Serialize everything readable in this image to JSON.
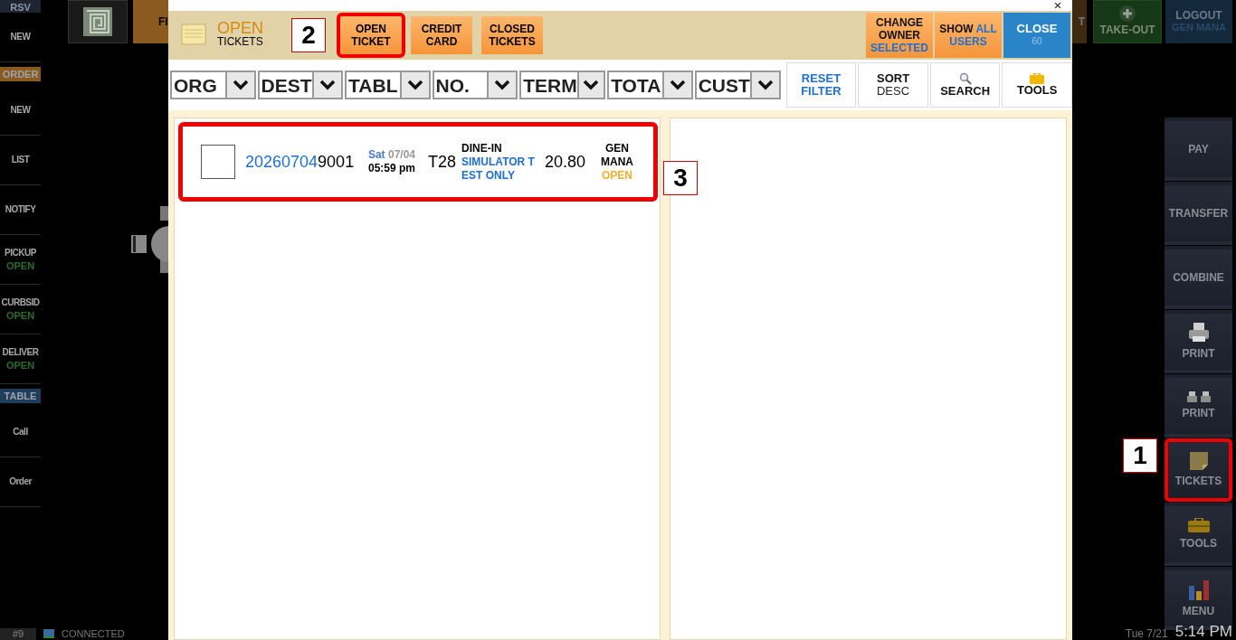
{
  "top_bar": {
    "corner_label": "RSV",
    "partial_tile": "FI",
    "partial_tile_right": "T",
    "take_out": "TAKE-OUT",
    "logout": {
      "label": "LOGOUT",
      "user": "GEN MANA"
    }
  },
  "sidebar": [
    {
      "kind": "item",
      "label": "NEW"
    },
    {
      "kind": "header",
      "label": "ORDER",
      "color": "#8a5a1e"
    },
    {
      "kind": "item",
      "label": "NEW"
    },
    {
      "kind": "item",
      "label": "LIST"
    },
    {
      "kind": "item",
      "label": "NOTIFY"
    },
    {
      "kind": "item",
      "label": "PICKUP",
      "status": "OPEN"
    },
    {
      "kind": "item",
      "label": "CURBSID",
      "status": "OPEN"
    },
    {
      "kind": "item",
      "label": "DELIVER",
      "status": "OPEN"
    },
    {
      "kind": "header",
      "label": "TABLE",
      "color": "#1f3d5c"
    },
    {
      "kind": "item",
      "label": "Call"
    },
    {
      "kind": "item",
      "label": "Order"
    }
  ],
  "right_buttons": [
    {
      "kind": "text",
      "label": "PAY",
      "selected": false
    },
    {
      "kind": "text",
      "label": "TRANSFER",
      "selected": false
    },
    {
      "kind": "text",
      "label": "COMBINE",
      "selected": false
    },
    {
      "kind": "printer",
      "label": "PRINT",
      "selected": false
    },
    {
      "kind": "printers",
      "label": "PRINT",
      "selected": false
    },
    {
      "kind": "ticket",
      "label": "TICKETS",
      "selected": true,
      "callout": "1"
    },
    {
      "kind": "toolbox",
      "label": "TOOLS",
      "selected": false
    },
    {
      "kind": "chart",
      "label": "MENU",
      "selected": false
    }
  ],
  "status_bar": {
    "station": "#9",
    "connection": "CONNECTED",
    "date": "Tue 7/21",
    "time": "5:14 PM"
  },
  "dialog": {
    "heading": {
      "title": "OPEN",
      "subtitle": "TICKETS"
    },
    "tabs": [
      {
        "lines": [
          "OPEN",
          "TICKET"
        ],
        "selected": true,
        "callout": "2"
      },
      {
        "lines": [
          "CREDIT",
          "CARD"
        ],
        "selected": false
      },
      {
        "lines": [
          "CLOSED",
          "TICKETS"
        ],
        "selected": false
      }
    ],
    "change_owner": {
      "lines": [
        "CHANGE",
        "OWNER"
      ],
      "state": "SELECTED"
    },
    "show_all": {
      "prefix": "SHOW",
      "highlight": "ALL",
      "suffix": "USERS"
    },
    "close": {
      "label": "CLOSE",
      "countdown": "60"
    },
    "filters": [
      "ORG",
      "DEST",
      "TABL",
      "NO.",
      "TERM",
      "TOTA",
      "CUST"
    ],
    "tools": [
      {
        "kind": "reset",
        "lines": [
          "RESET",
          "FILTER"
        ]
      },
      {
        "kind": "sort",
        "lines": [
          "SORT",
          "DESC"
        ]
      },
      {
        "kind": "search",
        "lines": [
          "SEARCH"
        ]
      },
      {
        "kind": "tools",
        "lines": [
          "TOOLS"
        ]
      }
    ],
    "tickets": [
      {
        "checked": false,
        "number_prefix": "20260704",
        "number_suffix": "9001",
        "day": "Sat",
        "date": "07/04",
        "time": "05:59 pm",
        "table": "T28",
        "order_type": "DINE-IN",
        "note_lines": [
          "SIMULATOR T",
          "EST ONLY"
        ],
        "total": "20.80",
        "owner_lines": [
          "GEN",
          "MANA"
        ],
        "status": "OPEN",
        "callout": "3"
      }
    ]
  }
}
